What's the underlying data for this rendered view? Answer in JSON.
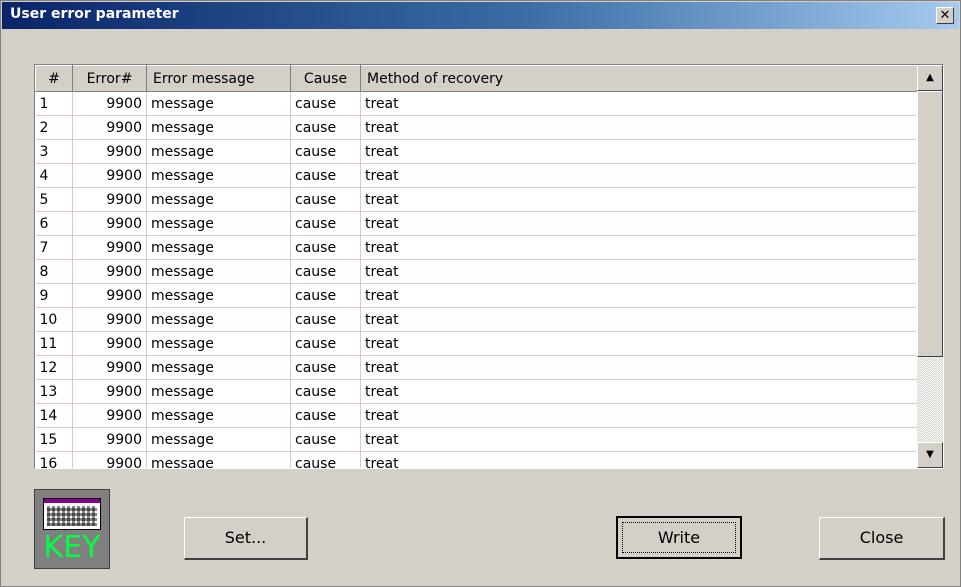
{
  "window": {
    "title": "User error parameter",
    "close_label": "✕"
  },
  "grid": {
    "columns": [
      "#",
      "Error#",
      "Error message",
      "Cause",
      "Method of recovery"
    ],
    "rows": [
      [
        "1",
        "9900",
        "message",
        "cause",
        "treat"
      ],
      [
        "2",
        "9900",
        "message",
        "cause",
        "treat"
      ],
      [
        "3",
        "9900",
        "message",
        "cause",
        "treat"
      ],
      [
        "4",
        "9900",
        "message",
        "cause",
        "treat"
      ],
      [
        "5",
        "9900",
        "message",
        "cause",
        "treat"
      ],
      [
        "6",
        "9900",
        "message",
        "cause",
        "treat"
      ],
      [
        "7",
        "9900",
        "message",
        "cause",
        "treat"
      ],
      [
        "8",
        "9900",
        "message",
        "cause",
        "treat"
      ],
      [
        "9",
        "9900",
        "message",
        "cause",
        "treat"
      ],
      [
        "10",
        "9900",
        "message",
        "cause",
        "treat"
      ],
      [
        "11",
        "9900",
        "message",
        "cause",
        "treat"
      ],
      [
        "12",
        "9900",
        "message",
        "cause",
        "treat"
      ],
      [
        "13",
        "9900",
        "message",
        "cause",
        "treat"
      ],
      [
        "14",
        "9900",
        "message",
        "cause",
        "treat"
      ],
      [
        "15",
        "9900",
        "message",
        "cause",
        "treat"
      ],
      [
        "16",
        "9900",
        "message",
        "cause",
        "treat"
      ]
    ]
  },
  "scrollbar": {
    "up_arrow": "▲",
    "down_arrow": "▼"
  },
  "key_icon": {
    "label": "KEY"
  },
  "buttons": {
    "set": "Set...",
    "write": "Write",
    "close": "Close"
  }
}
